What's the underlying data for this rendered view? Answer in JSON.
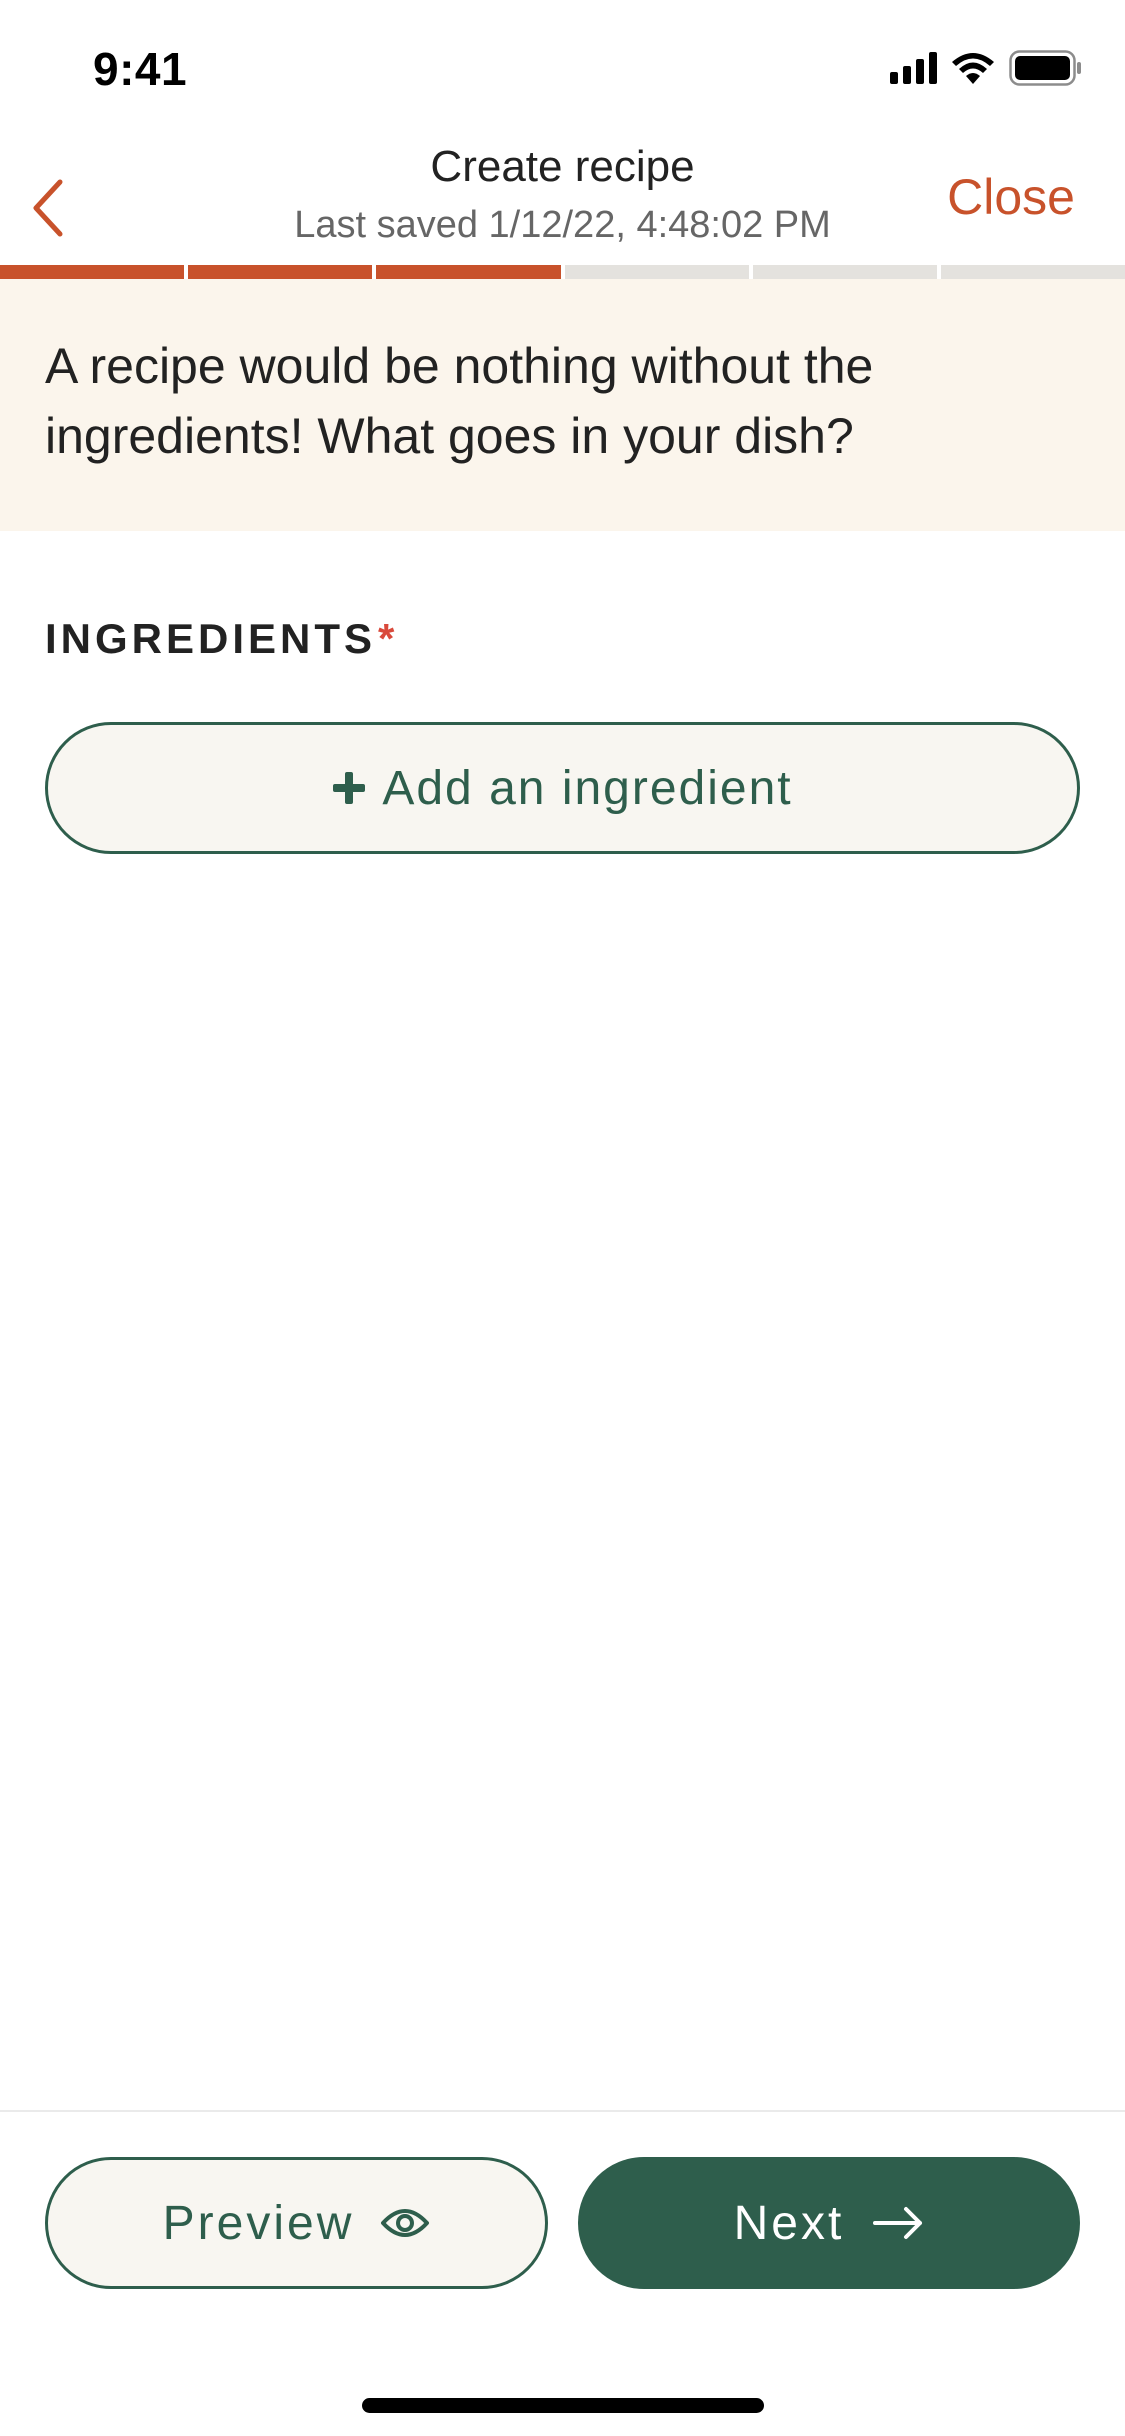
{
  "status_bar": {
    "time": "9:41",
    "icons": [
      "cellular-signal-icon",
      "wifi-icon",
      "battery-icon"
    ]
  },
  "header": {
    "back_icon": "chevron-left-icon",
    "title": "Create recipe",
    "subtitle": "Last saved 1/12/22, 4:48:02 PM",
    "close_label": "Close"
  },
  "progress": {
    "total_steps": 6,
    "completed_steps": 3,
    "fraction": 0.5
  },
  "banner": {
    "text": "A recipe would be nothing without the ingredients! What goes in your dish?"
  },
  "ingredients": {
    "label": "INGREDIENTS",
    "required_marker": "*",
    "add_label": "Add an ingredient",
    "add_icon": "plus-icon"
  },
  "footer": {
    "preview_label": "Preview",
    "preview_icon": "eye-icon",
    "next_label": "Next",
    "next_icon": "arrow-right-icon"
  },
  "colors": {
    "accent": "#C8522B",
    "primary": "#2E5E4C",
    "banner_bg": "#FBF5EC",
    "required": "#D9493B",
    "progress_track": "#E4E2DE"
  }
}
